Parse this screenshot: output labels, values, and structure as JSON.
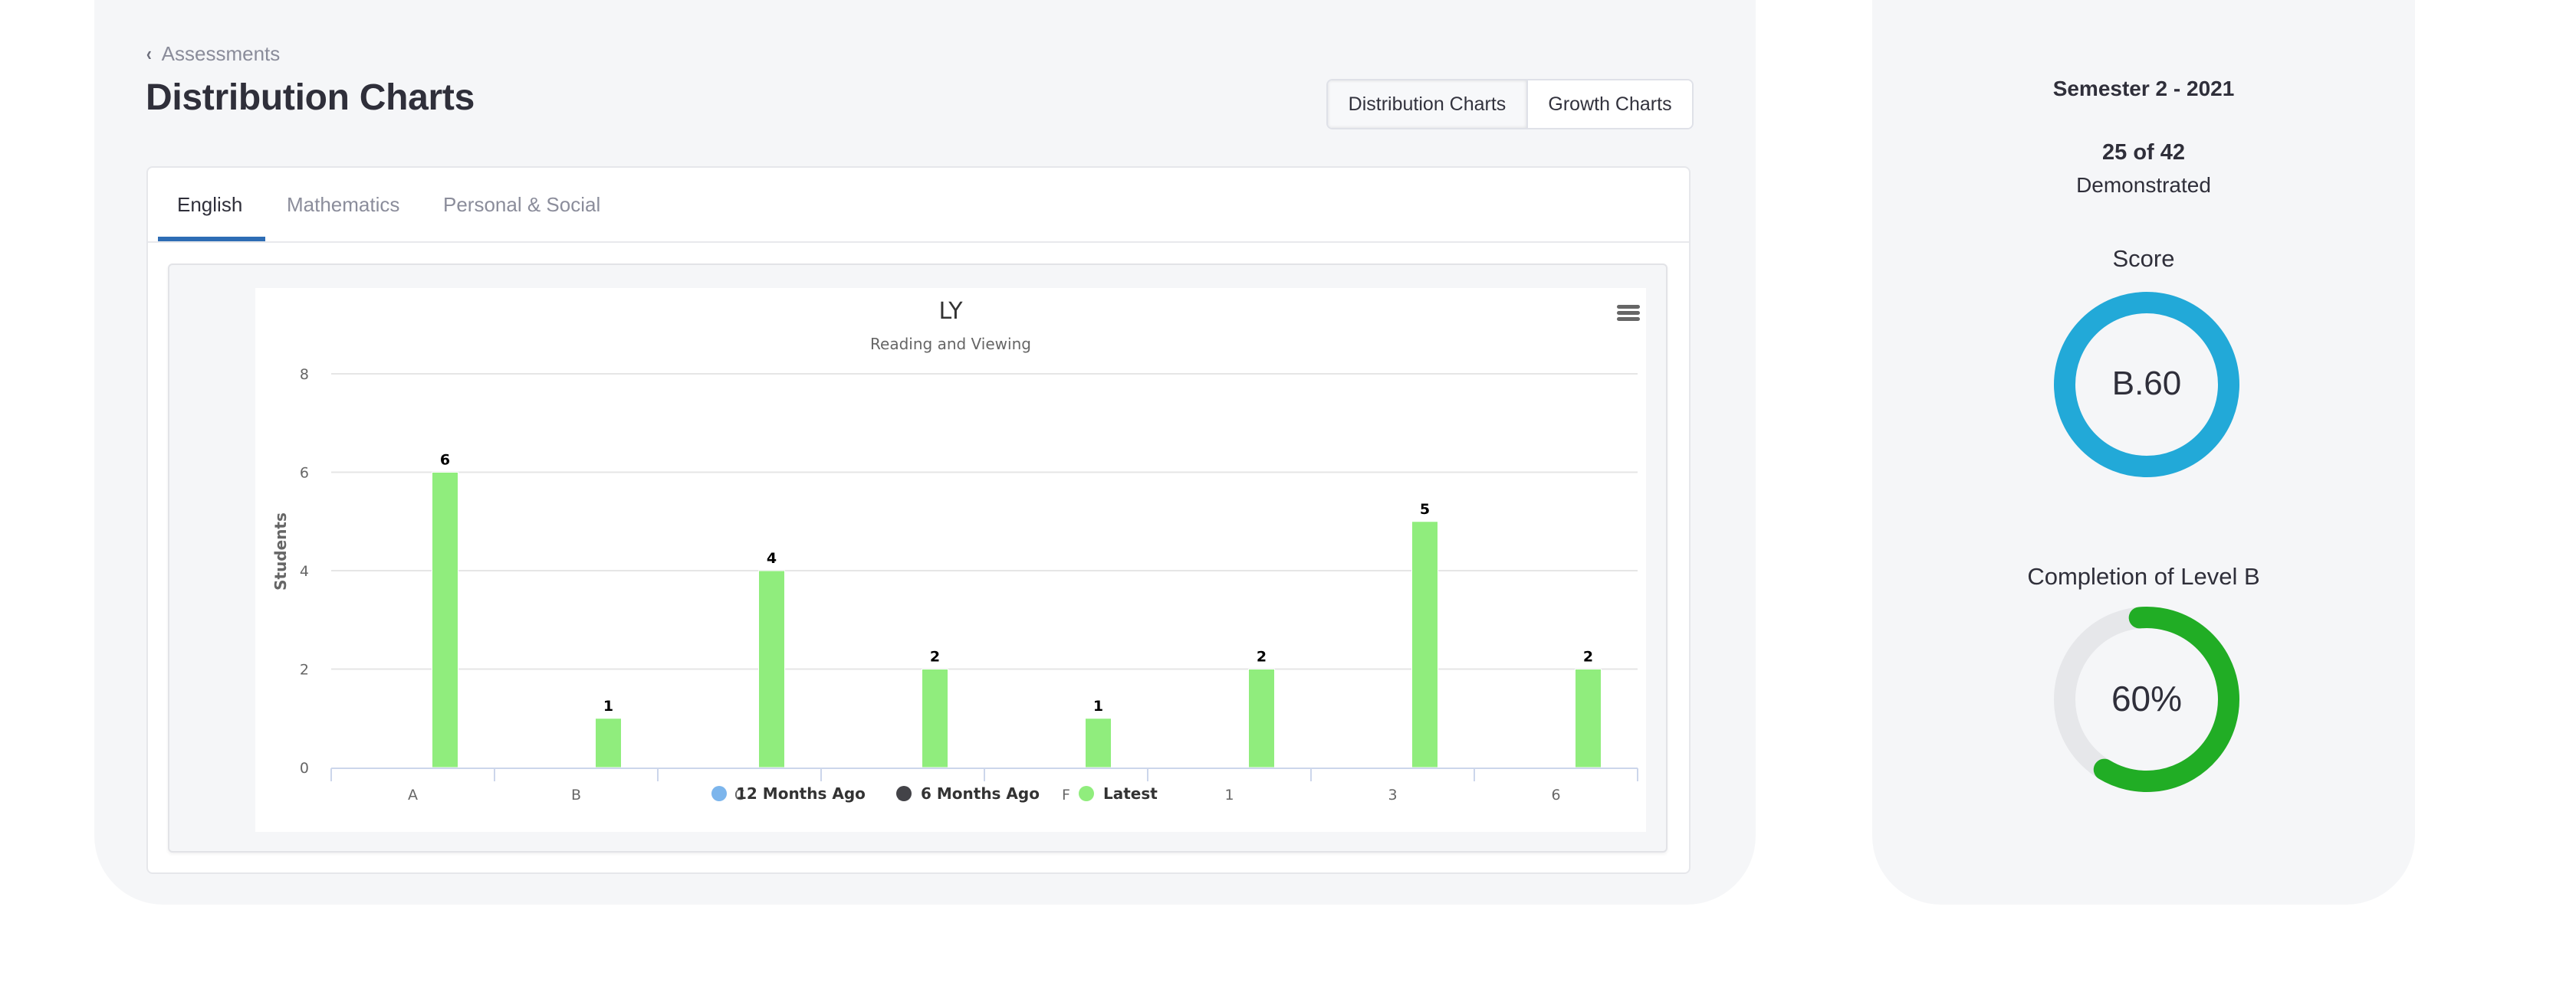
{
  "breadcrumb": {
    "back_label": "Assessments",
    "chevron_icon": "chevron-left-icon"
  },
  "page_title": "Distribution Charts",
  "view_toggle": {
    "options": [
      {
        "label": "Distribution Charts",
        "active": true
      },
      {
        "label": "Growth Charts",
        "active": false
      }
    ]
  },
  "tabs": [
    {
      "label": "English",
      "active": true
    },
    {
      "label": "Mathematics",
      "active": false
    },
    {
      "label": "Personal & Social",
      "active": false
    }
  ],
  "colors": {
    "tab_active_underline": "#2e6db5",
    "series_12_months": "#7cb5ec",
    "series_6_months": "#434348",
    "series_latest": "#90ed7d",
    "score_ring": "#22a9d8",
    "completion_ring": "#21ad25",
    "completion_track": "#e6e7ea"
  },
  "chart_menu_icon": "hamburger-menu-icon",
  "chart_data": {
    "type": "bar",
    "title": "LY",
    "subtitle": "Reading and Viewing",
    "xlabel": "",
    "ylabel": "Students",
    "ylim": [
      0,
      8
    ],
    "yticks": [
      0,
      2,
      4,
      6,
      8
    ],
    "grid": true,
    "legend_position": "bottom-center",
    "categories": [
      "A",
      "B",
      "C",
      "D",
      "F",
      "1",
      "3",
      "6"
    ],
    "series": [
      {
        "name": "12 Months Ago",
        "color": "#7cb5ec",
        "values": [
          null,
          null,
          null,
          null,
          null,
          null,
          null,
          null
        ]
      },
      {
        "name": "6 Months Ago",
        "color": "#434348",
        "values": [
          null,
          null,
          null,
          null,
          null,
          null,
          null,
          null
        ]
      },
      {
        "name": "Latest",
        "color": "#90ed7d",
        "values": [
          6,
          1,
          4,
          2,
          1,
          2,
          5,
          2
        ]
      }
    ]
  },
  "summary": {
    "semester": "Semester 2 - 2021",
    "demonstrated_count": "25 of 42",
    "demonstrated_label": "Demonstrated",
    "score_label": "Score",
    "score_value": "B.60",
    "completion_label": "Completion of Level B",
    "completion_value_text": "60%",
    "completion_fraction": 0.6
  }
}
